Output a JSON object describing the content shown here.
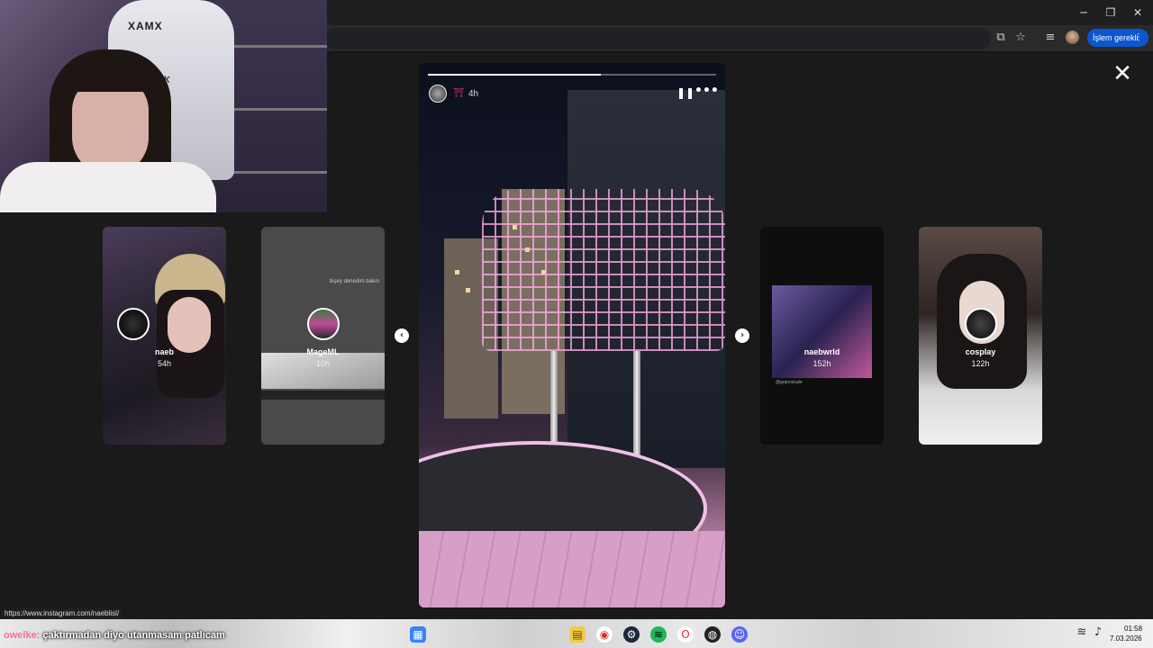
{
  "browser": {
    "window_controls": {
      "minimize": "─",
      "maximize": "❐",
      "close": "✕"
    },
    "toolbar_icons": [
      "cast-icon",
      "star-icon",
      "reading-list-icon",
      "profile-icon"
    ],
    "action_chip_label": "İşlem gerekli",
    "action_chip_menu": "⋮",
    "status_url": "https://www.instagram.com/naeblisl/"
  },
  "viewer": {
    "close_glyph": "✕",
    "prev_glyph": "‹",
    "next_glyph": "›",
    "side_stories": [
      {
        "name": "naeb",
        "time": "54h"
      },
      {
        "name": "MageML",
        "time": "10h",
        "caption": "bişey denedim bakın"
      },
      {
        "name": "naebwrld",
        "time": "152h",
        "credit": "@grannscale"
      },
      {
        "name": "cosplay",
        "time": "122h"
      }
    ],
    "main_story": {
      "badge_glyph": "⛩",
      "time": "4h",
      "pause_glyph": "❚❚",
      "more_glyph": "•••",
      "progress": 0.6
    }
  },
  "webcam": {
    "chair_brand": "XAMX",
    "chair_text": "BARK"
  },
  "taskbar": {
    "chat_user": "owelke:",
    "chat_message": "çaktırmadan diyo utanmasam patlıcam",
    "apps": [
      "windows-icon",
      "file-explorer-icon",
      "chrome-icon",
      "steam-icon",
      "spotify-icon",
      "opera-icon",
      "obs-icon",
      "discord-icon"
    ],
    "clock_time": "01:58",
    "clock_date": "7.03.2026"
  },
  "colors": {
    "accent": "#0b57d0",
    "badge_red": "#e0355f",
    "chat_user": "#ff6b9d"
  }
}
